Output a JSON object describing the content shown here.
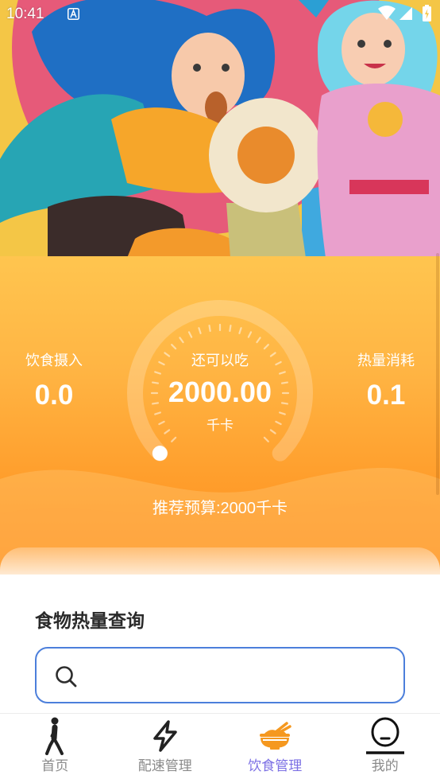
{
  "status_bar": {
    "time": "10:41",
    "icons": [
      "a-notification-icon",
      "wifi-icon",
      "signal-icon",
      "battery-icon"
    ]
  },
  "calorie_panel": {
    "intake": {
      "label": "饮食摄入",
      "value": "0.0"
    },
    "remaining": {
      "label": "还可以吃",
      "value": "2000.00",
      "unit": "千卡",
      "progress": 0
    },
    "burned": {
      "label": "热量消耗",
      "value": "0.1"
    },
    "budget": "推荐预算:2000千卡"
  },
  "food_search": {
    "title": "食物热量查询",
    "query": "",
    "icon": "search-icon"
  },
  "bottom_nav": {
    "items": [
      {
        "label": "首页",
        "icon": "walking-person-icon",
        "active": false
      },
      {
        "label": "配速管理",
        "icon": "lightning-icon",
        "active": false
      },
      {
        "label": "饮食管理",
        "icon": "rice-bowl-icon",
        "active": true
      },
      {
        "label": "我的",
        "icon": "profile-face-icon",
        "active": false
      }
    ]
  },
  "colors": {
    "panel_top": "#FFC54F",
    "panel_bottom": "#FF8E1E",
    "nav_active": "#7C70E4",
    "nav_inactive": "#8A8A8A",
    "search_border": "#4C7FDB",
    "bowl_icon": "#F5981F"
  }
}
